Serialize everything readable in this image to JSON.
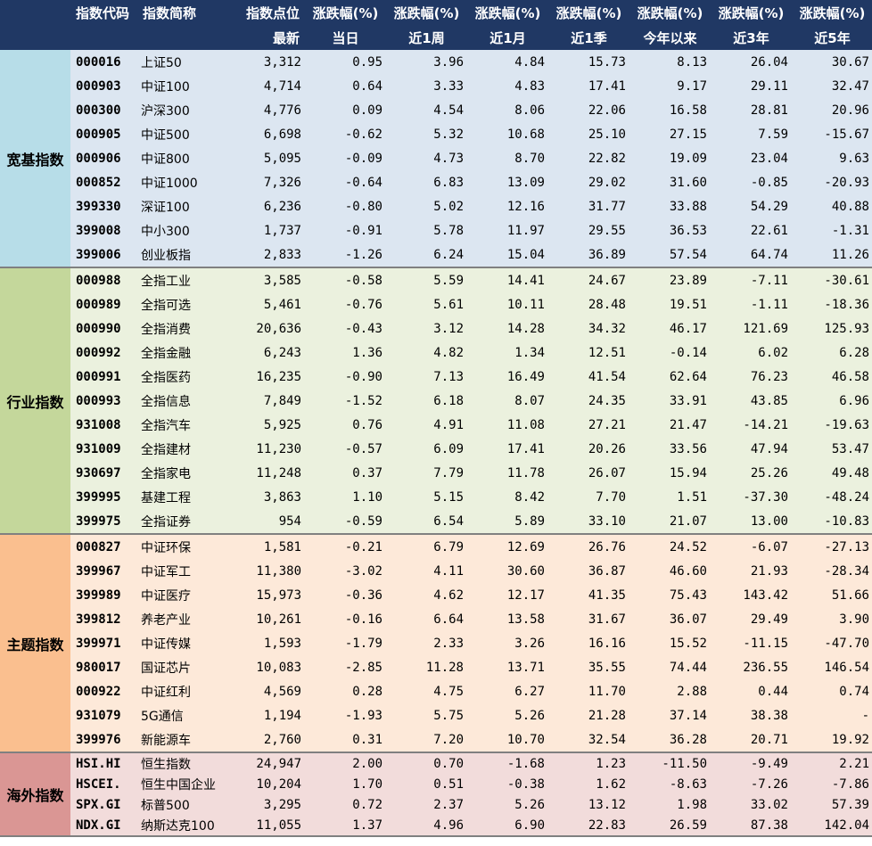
{
  "headers": {
    "code": "指数代码",
    "name": "指数简称",
    "point_top": "指数点位",
    "point_bottom": "最新",
    "chg_top": "涨跌幅(%)",
    "periods": [
      "当日",
      "近1周",
      "近1月",
      "近1季",
      "今年以来",
      "近3年",
      "近5年"
    ]
  },
  "groups": [
    {
      "label": "宽基指数",
      "rows": [
        [
          "000016",
          "上证50",
          "3,312",
          "0.95",
          "3.96",
          "4.84",
          "15.73",
          "8.13",
          "26.04",
          "30.67"
        ],
        [
          "000903",
          "中证100",
          "4,714",
          "0.64",
          "3.33",
          "4.83",
          "17.41",
          "9.17",
          "29.11",
          "32.47"
        ],
        [
          "000300",
          "沪深300",
          "4,776",
          "0.09",
          "4.54",
          "8.06",
          "22.06",
          "16.58",
          "28.81",
          "20.96"
        ],
        [
          "000905",
          "中证500",
          "6,698",
          "-0.62",
          "5.32",
          "10.68",
          "25.10",
          "27.15",
          "7.59",
          "-15.67"
        ],
        [
          "000906",
          "中证800",
          "5,095",
          "-0.09",
          "4.73",
          "8.70",
          "22.82",
          "19.09",
          "23.04",
          "9.63"
        ],
        [
          "000852",
          "中证1000",
          "7,326",
          "-0.64",
          "6.83",
          "13.09",
          "29.02",
          "31.60",
          "-0.85",
          "-20.93"
        ],
        [
          "399330",
          "深证100",
          "6,236",
          "-0.80",
          "5.02",
          "12.16",
          "31.77",
          "33.88",
          "54.29",
          "40.88"
        ],
        [
          "399008",
          "中小300",
          "1,737",
          "-0.91",
          "5.78",
          "11.97",
          "29.55",
          "36.53",
          "22.61",
          "-1.31"
        ],
        [
          "399006",
          "创业板指",
          "2,833",
          "-1.26",
          "6.24",
          "15.04",
          "36.89",
          "57.54",
          "64.74",
          "11.26"
        ]
      ]
    },
    {
      "label": "行业指数",
      "rows": [
        [
          "000988",
          "全指工业",
          "3,585",
          "-0.58",
          "5.59",
          "14.41",
          "24.67",
          "23.89",
          "-7.11",
          "-30.61"
        ],
        [
          "000989",
          "全指可选",
          "5,461",
          "-0.76",
          "5.61",
          "10.11",
          "28.48",
          "19.51",
          "-1.11",
          "-18.36"
        ],
        [
          "000990",
          "全指消费",
          "20,636",
          "-0.43",
          "3.12",
          "14.28",
          "34.32",
          "46.17",
          "121.69",
          "125.93"
        ],
        [
          "000992",
          "全指金融",
          "6,243",
          "1.36",
          "4.82",
          "1.34",
          "12.51",
          "-0.14",
          "6.02",
          "6.28"
        ],
        [
          "000991",
          "全指医药",
          "16,235",
          "-0.90",
          "7.13",
          "16.49",
          "41.54",
          "62.64",
          "76.23",
          "46.58"
        ],
        [
          "000993",
          "全指信息",
          "7,849",
          "-1.52",
          "6.18",
          "8.07",
          "24.35",
          "33.91",
          "43.85",
          "6.96"
        ],
        [
          "931008",
          "全指汽车",
          "5,925",
          "0.76",
          "4.91",
          "11.08",
          "27.21",
          "21.47",
          "-14.21",
          "-19.63"
        ],
        [
          "931009",
          "全指建材",
          "11,230",
          "-0.57",
          "6.09",
          "17.41",
          "20.26",
          "33.56",
          "47.94",
          "53.47"
        ],
        [
          "930697",
          "全指家电",
          "11,248",
          "0.37",
          "7.79",
          "11.78",
          "26.07",
          "15.94",
          "25.26",
          "49.48"
        ],
        [
          "399995",
          "基建工程",
          "3,863",
          "1.10",
          "5.15",
          "8.42",
          "7.70",
          "1.51",
          "-37.30",
          "-48.24"
        ],
        [
          "399975",
          "全指证券",
          "954",
          "-0.59",
          "6.54",
          "5.89",
          "33.10",
          "21.07",
          "13.00",
          "-10.83"
        ]
      ]
    },
    {
      "label": "主题指数",
      "rows": [
        [
          "000827",
          "中证环保",
          "1,581",
          "-0.21",
          "6.79",
          "12.69",
          "26.76",
          "24.52",
          "-6.07",
          "-27.13"
        ],
        [
          "399967",
          "中证军工",
          "11,380",
          "-3.02",
          "4.11",
          "30.60",
          "36.87",
          "46.60",
          "21.93",
          "-28.34"
        ],
        [
          "399989",
          "中证医疗",
          "15,973",
          "-0.36",
          "4.62",
          "12.17",
          "41.35",
          "75.43",
          "143.42",
          "51.66"
        ],
        [
          "399812",
          "养老产业",
          "10,261",
          "-0.16",
          "6.64",
          "13.58",
          "31.67",
          "36.07",
          "29.49",
          "3.90"
        ],
        [
          "399971",
          "中证传媒",
          "1,593",
          "-1.79",
          "2.33",
          "3.26",
          "16.16",
          "15.52",
          "-11.15",
          "-47.70"
        ],
        [
          "980017",
          "国证芯片",
          "10,083",
          "-2.85",
          "11.28",
          "13.71",
          "35.55",
          "74.44",
          "236.55",
          "146.54"
        ],
        [
          "000922",
          "中证红利",
          "4,569",
          "0.28",
          "4.75",
          "6.27",
          "11.70",
          "2.88",
          "0.44",
          "0.74"
        ],
        [
          "931079",
          "5G通信",
          "1,194",
          "-1.93",
          "5.75",
          "5.26",
          "21.28",
          "37.14",
          "38.38",
          "-"
        ],
        [
          "399976",
          "新能源车",
          "2,760",
          "0.31",
          "7.20",
          "10.70",
          "32.54",
          "36.28",
          "20.71",
          "19.92"
        ]
      ]
    },
    {
      "label": "海外指数",
      "rows": [
        [
          "HSI.HI",
          "恒生指数",
          "24,947",
          "2.00",
          "0.70",
          "-1.68",
          "1.23",
          "-11.50",
          "-9.49",
          "2.21"
        ],
        [
          "HSCEI.",
          "恒生中国企业",
          "10,204",
          "1.70",
          "0.51",
          "-0.38",
          "1.62",
          "-8.63",
          "-7.26",
          "-7.86"
        ],
        [
          "SPX.GI",
          "标普500",
          "3,295",
          "0.72",
          "2.37",
          "5.26",
          "13.12",
          "1.98",
          "33.02",
          "57.39"
        ],
        [
          "NDX.GI",
          "纳斯达克100",
          "11,055",
          "1.37",
          "4.96",
          "6.90",
          "22.83",
          "26.59",
          "87.38",
          "142.04"
        ]
      ]
    }
  ]
}
